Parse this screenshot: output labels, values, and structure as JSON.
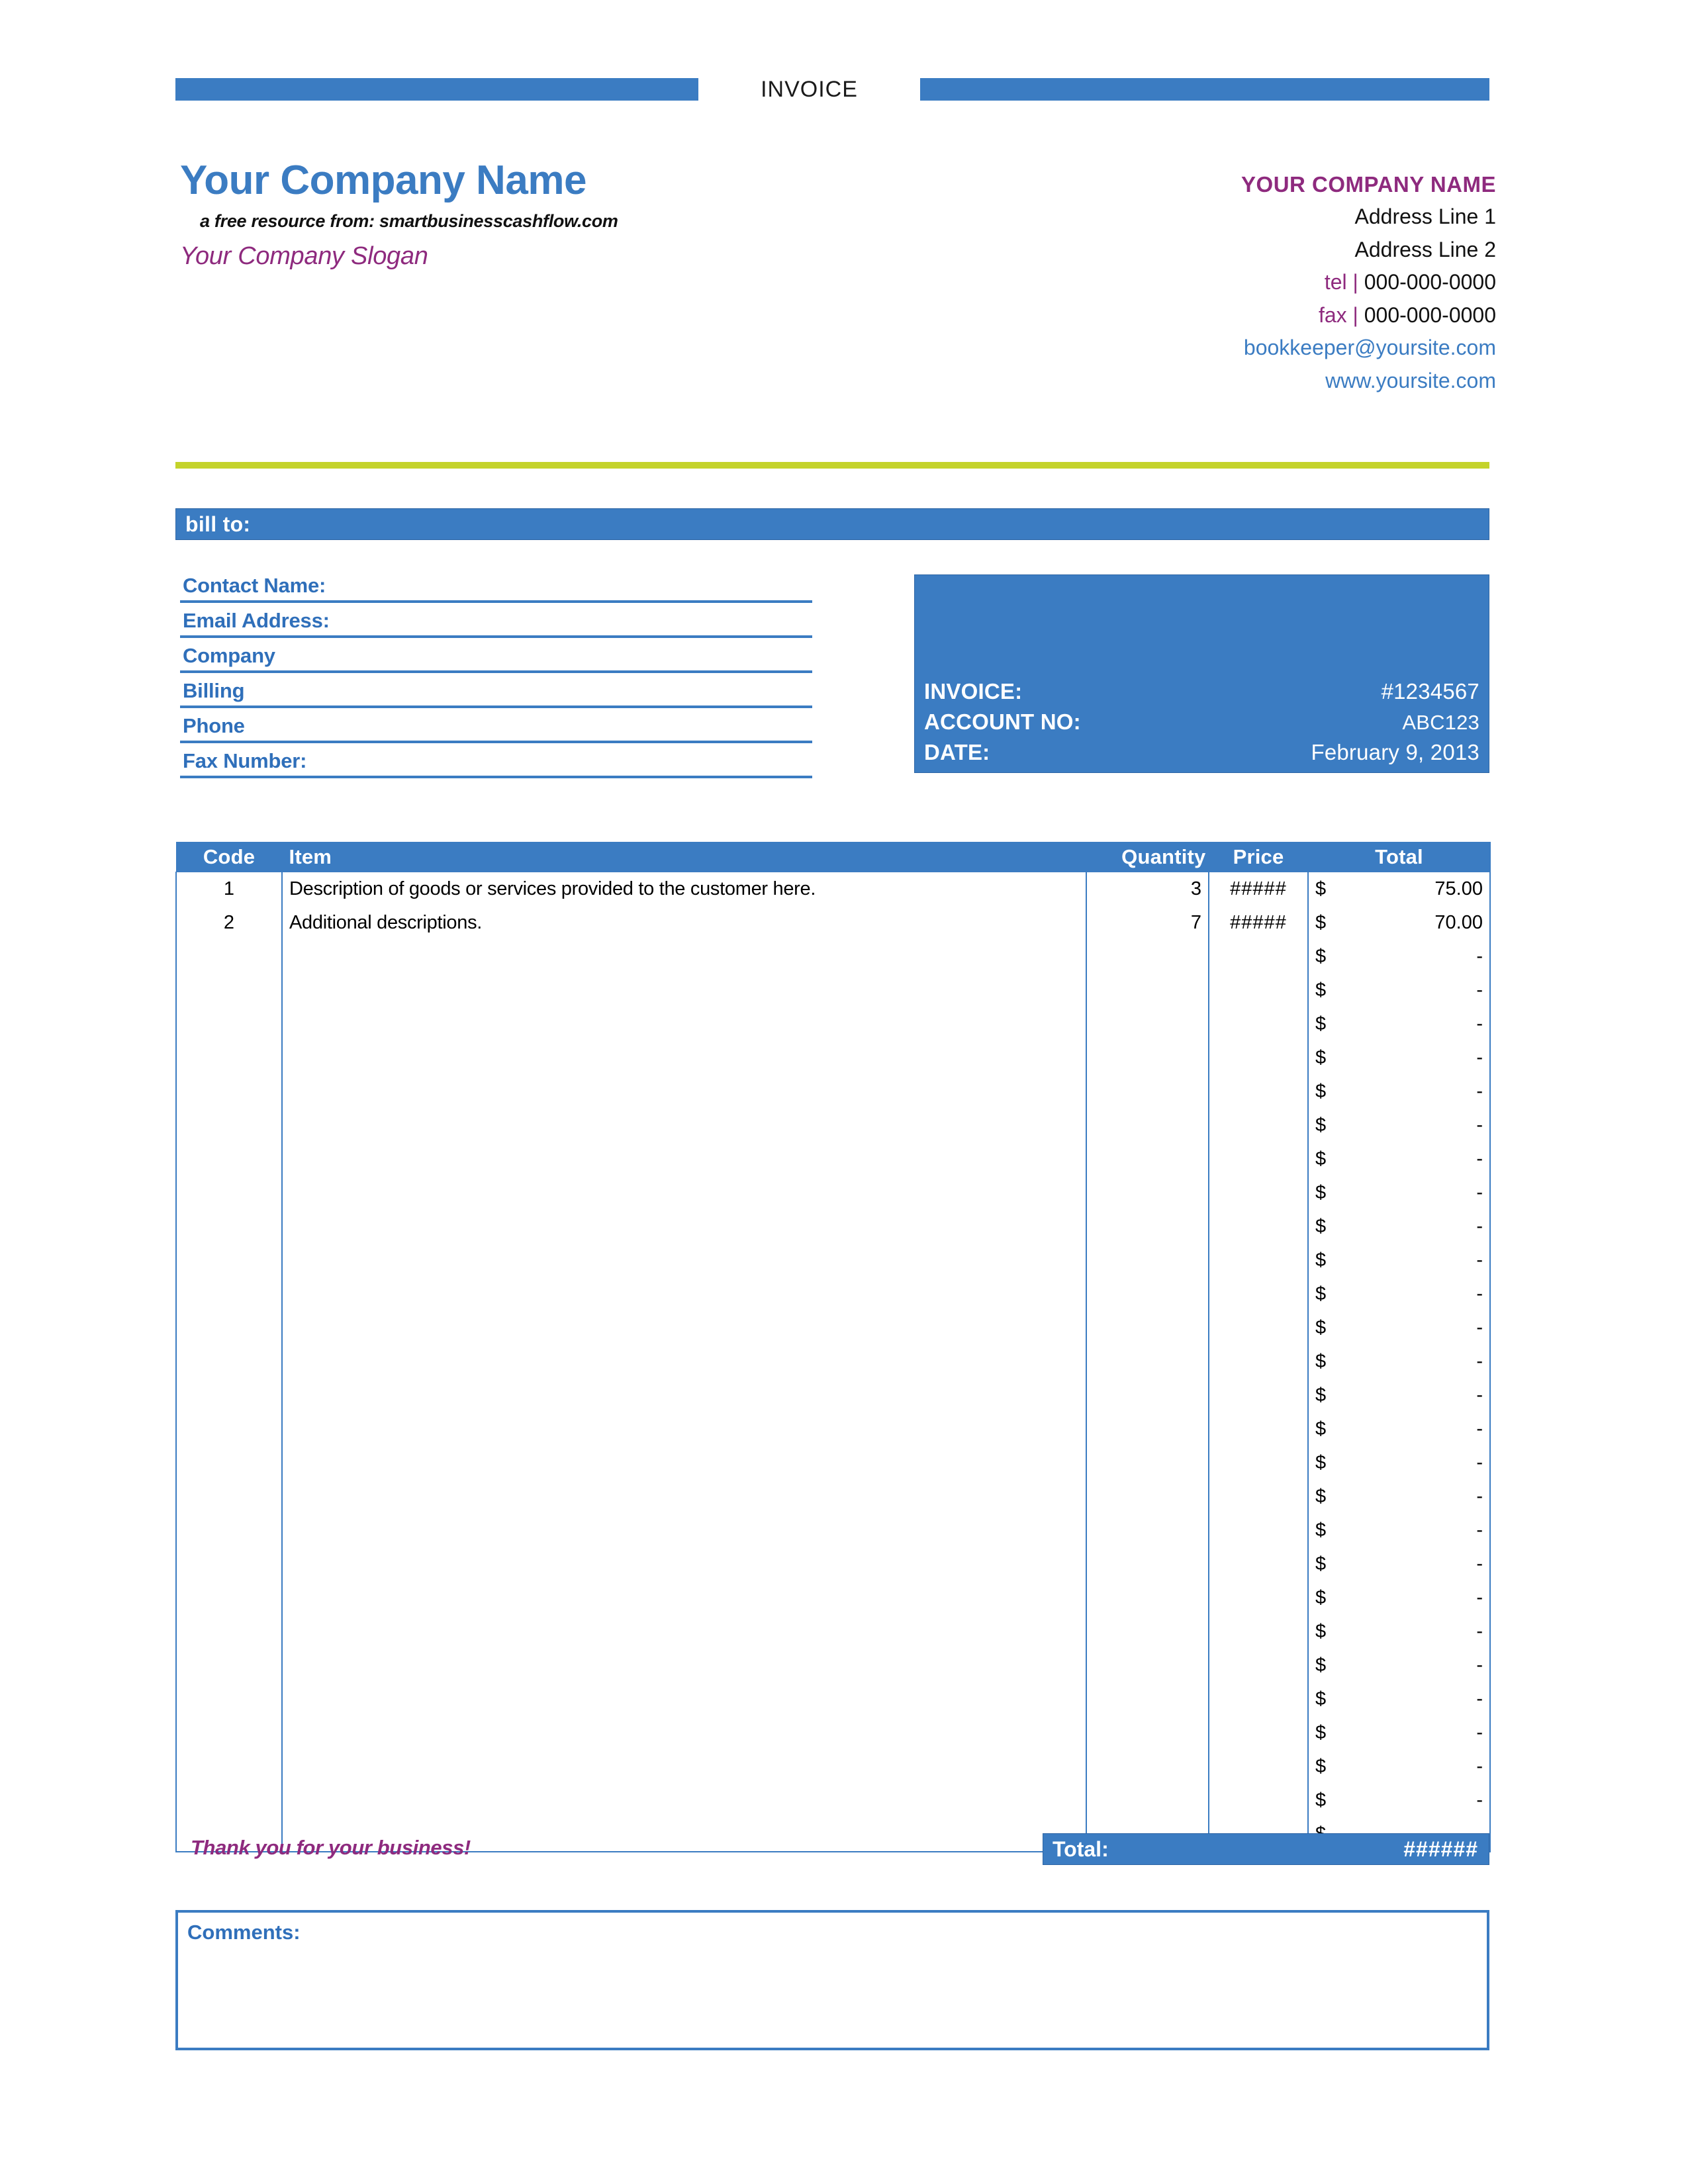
{
  "header": {
    "title": "INVOICE"
  },
  "company": {
    "name": "Your Company Name",
    "resource_line": "a free resource from: smartbusinesscashflow.com",
    "slogan": "Your Company Slogan"
  },
  "contact": {
    "name": "YOUR COMPANY NAME",
    "address_line_1": "Address Line 1",
    "address_line_2": "Address Line 2",
    "tel_label": "tel |",
    "tel_value": "000-000-0000",
    "fax_label": "fax |",
    "fax_value": "000-000-0000",
    "email": "bookkeeper@yoursite.com",
    "website": "www.yoursite.com"
  },
  "bill_to": {
    "heading": "bill to:",
    "fields": [
      {
        "label": "Contact Name:",
        "value": ""
      },
      {
        "label": "Email Address:",
        "value": ""
      },
      {
        "label": "Company",
        "value": ""
      },
      {
        "label": "Billing",
        "value": ""
      },
      {
        "label": "Phone",
        "value": ""
      },
      {
        "label": "Fax Number:",
        "value": ""
      }
    ]
  },
  "invoice_info": {
    "rows": [
      {
        "key": "INVOICE:",
        "value": "#1234567"
      },
      {
        "key": "ACCOUNT NO:",
        "value": "ABC123"
      },
      {
        "key": "DATE:",
        "value": "February 9, 2013"
      }
    ]
  },
  "items": {
    "columns": [
      "Code",
      "Item",
      "Quantity",
      "Price",
      "Total"
    ],
    "rows": [
      {
        "code": "1",
        "item": "Description of goods or services provided to the customer here.",
        "quantity": "3",
        "price": "#####",
        "total_symbol": "$",
        "total_amount": "75.00"
      },
      {
        "code": "2",
        "item": "Additional descriptions.",
        "quantity": "7",
        "price": "#####",
        "total_symbol": "$",
        "total_amount": "70.00"
      },
      {
        "code": "",
        "item": "",
        "quantity": "",
        "price": "",
        "total_symbol": "$",
        "total_amount": "-"
      },
      {
        "code": "",
        "item": "",
        "quantity": "",
        "price": "",
        "total_symbol": "$",
        "total_amount": "-"
      },
      {
        "code": "",
        "item": "",
        "quantity": "",
        "price": "",
        "total_symbol": "$",
        "total_amount": "-"
      },
      {
        "code": "",
        "item": "",
        "quantity": "",
        "price": "",
        "total_symbol": "$",
        "total_amount": "-"
      },
      {
        "code": "",
        "item": "",
        "quantity": "",
        "price": "",
        "total_symbol": "$",
        "total_amount": "-"
      },
      {
        "code": "",
        "item": "",
        "quantity": "",
        "price": "",
        "total_symbol": "$",
        "total_amount": "-"
      },
      {
        "code": "",
        "item": "",
        "quantity": "",
        "price": "",
        "total_symbol": "$",
        "total_amount": "-"
      },
      {
        "code": "",
        "item": "",
        "quantity": "",
        "price": "",
        "total_symbol": "$",
        "total_amount": "-"
      },
      {
        "code": "",
        "item": "",
        "quantity": "",
        "price": "",
        "total_symbol": "$",
        "total_amount": "-"
      },
      {
        "code": "",
        "item": "",
        "quantity": "",
        "price": "",
        "total_symbol": "$",
        "total_amount": "-"
      },
      {
        "code": "",
        "item": "",
        "quantity": "",
        "price": "",
        "total_symbol": "$",
        "total_amount": "-"
      },
      {
        "code": "",
        "item": "",
        "quantity": "",
        "price": "",
        "total_symbol": "$",
        "total_amount": "-"
      },
      {
        "code": "",
        "item": "",
        "quantity": "",
        "price": "",
        "total_symbol": "$",
        "total_amount": "-"
      },
      {
        "code": "",
        "item": "",
        "quantity": "",
        "price": "",
        "total_symbol": "$",
        "total_amount": "-"
      },
      {
        "code": "",
        "item": "",
        "quantity": "",
        "price": "",
        "total_symbol": "$",
        "total_amount": "-"
      },
      {
        "code": "",
        "item": "",
        "quantity": "",
        "price": "",
        "total_symbol": "$",
        "total_amount": "-"
      },
      {
        "code": "",
        "item": "",
        "quantity": "",
        "price": "",
        "total_symbol": "$",
        "total_amount": "-"
      },
      {
        "code": "",
        "item": "",
        "quantity": "",
        "price": "",
        "total_symbol": "$",
        "total_amount": "-"
      },
      {
        "code": "",
        "item": "",
        "quantity": "",
        "price": "",
        "total_symbol": "$",
        "total_amount": "-"
      },
      {
        "code": "",
        "item": "",
        "quantity": "",
        "price": "",
        "total_symbol": "$",
        "total_amount": "-"
      },
      {
        "code": "",
        "item": "",
        "quantity": "",
        "price": "",
        "total_symbol": "$",
        "total_amount": "-"
      },
      {
        "code": "",
        "item": "",
        "quantity": "",
        "price": "",
        "total_symbol": "$",
        "total_amount": "-"
      },
      {
        "code": "",
        "item": "",
        "quantity": "",
        "price": "",
        "total_symbol": "$",
        "total_amount": "-"
      },
      {
        "code": "",
        "item": "",
        "quantity": "",
        "price": "",
        "total_symbol": "$",
        "total_amount": "-"
      },
      {
        "code": "",
        "item": "",
        "quantity": "",
        "price": "",
        "total_symbol": "$",
        "total_amount": "-"
      },
      {
        "code": "",
        "item": "",
        "quantity": "",
        "price": "",
        "total_symbol": "$",
        "total_amount": "-"
      },
      {
        "code": "",
        "item": "",
        "quantity": "",
        "price": "",
        "total_symbol": "$",
        "total_amount": "-"
      }
    ]
  },
  "footer": {
    "total_label": "Total:",
    "total_value": "######",
    "thank_you": "Thank you for your business!",
    "comments_label": "Comments:"
  },
  "colors": {
    "accent_blue": "#3B7CC2",
    "accent_purple": "#8E2A7E",
    "accent_green": "#C4D32B",
    "link_blue": "#3B7CC2"
  }
}
